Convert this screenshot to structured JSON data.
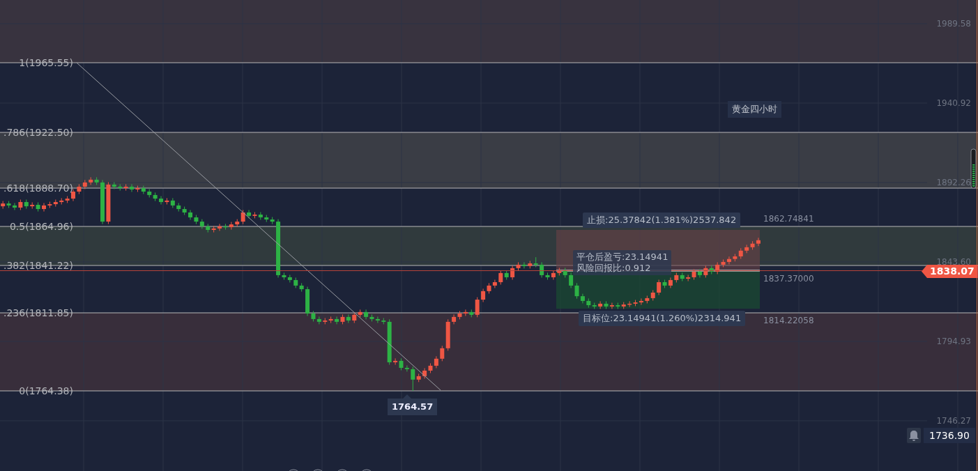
{
  "chart_title": "黄金四小时",
  "fibonacci": {
    "levels": [
      {
        "label": "1(1965.55)"
      },
      {
        "label": ".786(1922.50)"
      },
      {
        "label": ".618(1888.70)"
      },
      {
        "label": "0.5(1864.96)"
      },
      {
        "label": ".382(1841.22)"
      },
      {
        "label": ".236(1811.85)"
      },
      {
        "label": "0(1764.38)"
      }
    ]
  },
  "chart_data": {
    "type": "candlestick",
    "grid": true,
    "ylim": [
      1715.5,
      2004.09
    ],
    "yticks": [
      {
        "value": 1989.58,
        "label": "1989.58"
      },
      {
        "value": 1940.92,
        "label": "1940.92"
      },
      {
        "value": 1892.26,
        "label": "1892.26"
      },
      {
        "value": 1843.6,
        "label": "1843.60"
      },
      {
        "value": 1794.93,
        "label": "1794.93"
      },
      {
        "value": 1746.27,
        "label": "1746.27"
      }
    ],
    "categories": [
      null,
      null,
      null,
      null,
      null,
      null,
      null,
      null,
      null,
      null,
      null,
      null,
      null,
      null,
      null,
      null,
      null,
      null,
      null,
      null,
      null,
      null,
      null,
      null,
      null,
      null,
      null,
      null,
      null,
      null,
      null,
      null,
      null,
      null,
      null,
      null,
      null,
      null,
      null,
      null,
      null,
      null,
      null,
      null,
      null,
      null,
      null,
      null,
      null,
      null,
      null,
      null,
      null,
      null,
      null,
      null,
      null,
      null,
      null,
      null,
      null,
      null,
      null,
      null,
      null,
      null,
      null,
      null,
      null,
      null,
      null,
      null,
      null,
      null,
      null,
      null,
      null,
      null,
      null,
      null,
      null,
      null,
      null,
      null,
      null,
      null,
      null,
      null,
      null,
      null,
      null,
      null,
      null,
      null,
      null,
      null,
      null,
      null,
      null,
      null,
      null,
      null,
      null,
      null,
      null,
      null,
      null,
      null,
      null,
      null,
      null,
      null,
      null,
      null,
      null,
      null,
      null,
      null,
      null,
      null,
      null,
      null,
      null,
      null,
      null,
      null,
      null,
      null,
      null,
      null,
      null,
      null,
      null,
      null,
      null,
      null,
      null,
      null,
      null,
      null,
      null,
      null,
      null,
      null,
      null,
      null,
      null,
      null,
      null,
      null,
      null,
      null,
      null,
      null,
      null,
      null,
      null,
      null,
      null,
      null,
      null,
      null,
      null,
      null,
      null,
      null,
      null
    ],
    "ohlc": [
      [
        1877.7,
        1880.9,
        1876.2,
        1879.4
      ],
      [
        1879.4,
        1880.9,
        1876.7,
        1878.2
      ],
      [
        1878.2,
        1879.7,
        1875.4,
        1876.9
      ],
      [
        1876.9,
        1881.8,
        1875.4,
        1880.3
      ],
      [
        1880.3,
        1881.8,
        1876.2,
        1877.7
      ],
      [
        1877.7,
        1880.1,
        1876.2,
        1878.6
      ],
      [
        1878.6,
        1880.1,
        1874.5,
        1876.0
      ],
      [
        1876.0,
        1879.7,
        1874.5,
        1878.2
      ],
      [
        1878.2,
        1880.5,
        1876.7,
        1879.0
      ],
      [
        1879.0,
        1881.8,
        1877.5,
        1880.3
      ],
      [
        1880.3,
        1882.7,
        1878.8,
        1881.2
      ],
      [
        1881.2,
        1883.9,
        1879.7,
        1882.4
      ],
      [
        1882.4,
        1888.2,
        1880.9,
        1886.7
      ],
      [
        1886.7,
        1891.2,
        1885.2,
        1889.7
      ],
      [
        1889.7,
        1893.8,
        1888.2,
        1892.3
      ],
      [
        1892.3,
        1895.5,
        1890.8,
        1894.0
      ],
      [
        1894.0,
        1895.5,
        1890.8,
        1892.3
      ],
      [
        1892.3,
        1893.8,
        1866.8,
        1868.3
      ],
      [
        1868.3,
        1892.5,
        1866.8,
        1891.0
      ],
      [
        1891.0,
        1892.5,
        1888.2,
        1889.7
      ],
      [
        1889.7,
        1891.2,
        1887.3,
        1888.8
      ],
      [
        1888.8,
        1891.2,
        1887.3,
        1889.7
      ],
      [
        1889.7,
        1891.2,
        1886.5,
        1888.0
      ],
      [
        1888.0,
        1890.3,
        1886.5,
        1888.8
      ],
      [
        1888.8,
        1890.3,
        1885.2,
        1886.7
      ],
      [
        1886.7,
        1888.2,
        1883.1,
        1884.6
      ],
      [
        1884.6,
        1886.1,
        1880.9,
        1882.4
      ],
      [
        1882.4,
        1883.9,
        1878.8,
        1880.3
      ],
      [
        1880.3,
        1882.7,
        1878.8,
        1881.2
      ],
      [
        1881.2,
        1882.7,
        1876.7,
        1878.2
      ],
      [
        1878.2,
        1879.7,
        1874.5,
        1876.0
      ],
      [
        1876.0,
        1877.5,
        1872.4,
        1873.9
      ],
      [
        1873.9,
        1875.4,
        1869.4,
        1870.9
      ],
      [
        1870.9,
        1872.4,
        1866.8,
        1868.3
      ],
      [
        1868.3,
        1869.8,
        1863.9,
        1865.4
      ],
      [
        1865.4,
        1866.9,
        1861.7,
        1863.2
      ],
      [
        1863.2,
        1865.6,
        1861.7,
        1864.1
      ],
      [
        1864.1,
        1866.9,
        1862.6,
        1865.4
      ],
      [
        1865.4,
        1866.9,
        1863.4,
        1864.9
      ],
      [
        1864.9,
        1868.1,
        1863.4,
        1866.6
      ],
      [
        1866.6,
        1869.8,
        1865.1,
        1868.3
      ],
      [
        1868.3,
        1875.4,
        1866.8,
        1873.9
      ],
      [
        1873.9,
        1875.4,
        1870.3,
        1871.8
      ],
      [
        1871.8,
        1874.1,
        1870.3,
        1872.6
      ],
      [
        1872.6,
        1874.1,
        1869.4,
        1870.9
      ],
      [
        1870.9,
        1872.4,
        1868.1,
        1869.6
      ],
      [
        1869.6,
        1871.1,
        1866.8,
        1868.3
      ],
      [
        1868.3,
        1869.8,
        1834.0,
        1835.5
      ],
      [
        1835.5,
        1837.0,
        1832.7,
        1834.2
      ],
      [
        1834.2,
        1835.7,
        1831.0,
        1832.5
      ],
      [
        1832.5,
        1834.0,
        1827.6,
        1829.1
      ],
      [
        1829.1,
        1830.6,
        1825.4,
        1826.9
      ],
      [
        1826.9,
        1828.4,
        1810.5,
        1812.0
      ],
      [
        1812.0,
        1813.5,
        1807.1,
        1808.6
      ],
      [
        1808.6,
        1810.1,
        1805.4,
        1806.9
      ],
      [
        1806.9,
        1809.2,
        1805.4,
        1807.7
      ],
      [
        1807.7,
        1810.1,
        1806.2,
        1808.6
      ],
      [
        1808.6,
        1810.1,
        1805.4,
        1806.9
      ],
      [
        1806.9,
        1811.4,
        1805.4,
        1809.9
      ],
      [
        1809.9,
        1811.4,
        1806.2,
        1807.7
      ],
      [
        1807.7,
        1812.7,
        1806.2,
        1811.2
      ],
      [
        1811.2,
        1814.4,
        1809.7,
        1812.9
      ],
      [
        1812.9,
        1814.4,
        1808.4,
        1809.9
      ],
      [
        1809.9,
        1811.4,
        1807.1,
        1808.6
      ],
      [
        1808.6,
        1810.1,
        1806.2,
        1807.7
      ],
      [
        1807.7,
        1809.2,
        1805.4,
        1806.9
      ],
      [
        1806.9,
        1808.4,
        1780.6,
        1782.1
      ],
      [
        1782.1,
        1784.5,
        1780.6,
        1783.0
      ],
      [
        1783.0,
        1784.5,
        1777.2,
        1778.7
      ],
      [
        1778.7,
        1780.2,
        1776.4,
        1777.9
      ],
      [
        1777.9,
        1779.4,
        1764.6,
        1771.5
      ],
      [
        1771.5,
        1775.1,
        1770.0,
        1773.6
      ],
      [
        1773.6,
        1778.5,
        1772.1,
        1777.0
      ],
      [
        1777.0,
        1781.5,
        1775.5,
        1780.0
      ],
      [
        1780.0,
        1785.8,
        1778.5,
        1784.3
      ],
      [
        1784.3,
        1792.2,
        1782.8,
        1790.7
      ],
      [
        1790.7,
        1808.4,
        1789.2,
        1806.9
      ],
      [
        1806.9,
        1811.4,
        1805.4,
        1809.9
      ],
      [
        1809.9,
        1813.5,
        1808.4,
        1812.0
      ],
      [
        1812.0,
        1814.4,
        1810.5,
        1812.9
      ],
      [
        1812.9,
        1814.4,
        1809.7,
        1811.2
      ],
      [
        1811.2,
        1822.0,
        1809.7,
        1820.5
      ],
      [
        1820.5,
        1827.2,
        1819.0,
        1825.7
      ],
      [
        1825.7,
        1830.6,
        1824.2,
        1829.1
      ],
      [
        1829.1,
        1832.7,
        1827.6,
        1831.2
      ],
      [
        1831.2,
        1838.3,
        1829.7,
        1836.8
      ],
      [
        1836.8,
        1838.3,
        1832.7,
        1834.2
      ],
      [
        1834.2,
        1841.3,
        1832.7,
        1839.8
      ],
      [
        1839.8,
        1843.4,
        1838.3,
        1841.9
      ],
      [
        1841.9,
        1843.4,
        1839.6,
        1841.1
      ],
      [
        1841.1,
        1844.2,
        1839.6,
        1842.7
      ],
      [
        1842.7,
        1846.5,
        1840.4,
        1841.9
      ],
      [
        1841.9,
        1843.4,
        1834.0,
        1835.5
      ],
      [
        1835.5,
        1837.0,
        1832.7,
        1834.2
      ],
      [
        1834.2,
        1838.3,
        1832.7,
        1836.8
      ],
      [
        1836.8,
        1840.0,
        1835.3,
        1838.5
      ],
      [
        1838.5,
        1840.0,
        1834.0,
        1835.5
      ],
      [
        1835.5,
        1837.0,
        1827.6,
        1829.1
      ],
      [
        1829.1,
        1830.6,
        1821.1,
        1822.6
      ],
      [
        1822.6,
        1824.1,
        1818.2,
        1819.7
      ],
      [
        1819.7,
        1821.2,
        1815.6,
        1817.1
      ],
      [
        1817.1,
        1818.6,
        1814.8,
        1816.3
      ],
      [
        1816.3,
        1819.5,
        1814.8,
        1818.0
      ],
      [
        1818.0,
        1819.5,
        1814.8,
        1816.3
      ],
      [
        1816.3,
        1818.6,
        1814.8,
        1817.1
      ],
      [
        1817.1,
        1818.6,
        1814.8,
        1816.3
      ],
      [
        1816.3,
        1819.0,
        1814.8,
        1817.5
      ],
      [
        1817.5,
        1819.5,
        1816.0,
        1818.0
      ],
      [
        1818.0,
        1820.3,
        1816.5,
        1818.8
      ],
      [
        1818.8,
        1821.2,
        1817.3,
        1819.7
      ],
      [
        1819.7,
        1822.9,
        1818.2,
        1821.4
      ],
      [
        1821.4,
        1826.3,
        1819.9,
        1824.8
      ],
      [
        1824.8,
        1832.7,
        1823.3,
        1831.2
      ],
      [
        1831.2,
        1832.7,
        1827.6,
        1829.1
      ],
      [
        1829.1,
        1834.0,
        1827.6,
        1832.5
      ],
      [
        1832.5,
        1837.0,
        1831.0,
        1835.5
      ],
      [
        1835.5,
        1837.0,
        1831.8,
        1833.3
      ],
      [
        1833.3,
        1835.7,
        1831.8,
        1834.2
      ],
      [
        1834.2,
        1839.1,
        1832.7,
        1837.6
      ],
      [
        1837.6,
        1839.1,
        1834.0,
        1835.5
      ],
      [
        1835.5,
        1841.3,
        1834.0,
        1839.8
      ],
      [
        1839.8,
        1841.3,
        1836.1,
        1837.6
      ],
      [
        1837.6,
        1843.4,
        1836.1,
        1841.9
      ],
      [
        1841.9,
        1845.1,
        1840.4,
        1843.6
      ],
      [
        1843.6,
        1846.9,
        1842.1,
        1845.4
      ],
      [
        1845.4,
        1848.5,
        1843.9,
        1847.0
      ],
      [
        1847.0,
        1852.0,
        1845.5,
        1850.5
      ],
      [
        1850.5,
        1854.1,
        1849.0,
        1852.6
      ],
      [
        1852.6,
        1856.3,
        1851.1,
        1854.8
      ],
      [
        1854.8,
        1858.4,
        1853.3,
        1856.9
      ],
      null,
      null,
      null,
      null,
      null,
      null,
      null,
      null,
      null,
      null,
      null,
      null,
      null,
      null,
      null,
      null,
      null,
      null,
      null,
      null,
      null,
      null,
      null,
      null,
      null,
      null,
      null,
      null,
      null,
      null,
      null,
      null,
      null,
      null,
      null,
      null,
      null
    ]
  },
  "position_tool": {
    "stop_loss_label": "止损:25.37842(1.381%)2537.842",
    "stop_price": "1862.74841",
    "pnl_label": "平仓后盈亏:23.14941",
    "risk_reward_label": "风险回报比:0.912",
    "entry_price": "1837.37000",
    "target_label": "目标位:23.14941(1.260%)2314.941",
    "target_price": "1814.22058"
  },
  "low_marker": "1764.57",
  "current_price": "1838.07",
  "alert": {
    "price": "1736.90"
  }
}
